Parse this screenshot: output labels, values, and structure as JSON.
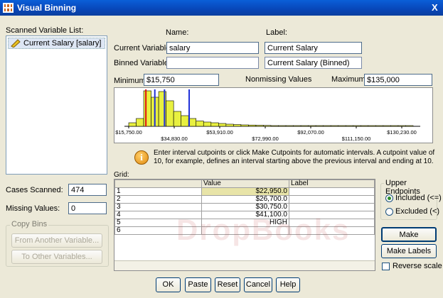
{
  "window": {
    "title": "Visual Binning",
    "close_glyph": "X"
  },
  "scanned": {
    "label": "Scanned Variable List:",
    "items": [
      "Current Salary [salary]"
    ]
  },
  "headers": {
    "name": "Name:",
    "label": "Label:"
  },
  "current_variable": {
    "label": "Current Variable:",
    "name": "salary",
    "var_label": "Current Salary"
  },
  "binned_variable": {
    "label": "Binned Variable:",
    "name": "",
    "var_label": "Current Salary (Binned)"
  },
  "stats": {
    "minimum_label": "Minimum:",
    "minimum": "$15,750",
    "nonmissing_label": "Nonmissing Values",
    "maximum_label": "Maximum:",
    "maximum": "$135,000"
  },
  "histogram": {
    "bars": [
      0.1,
      0.22,
      1.0,
      0.82,
      0.98,
      0.72,
      0.42,
      0.3,
      0.22,
      0.15,
      0.12,
      0.1,
      0.08,
      0.06,
      0.05,
      0.04,
      0.035,
      0.03,
      0.025,
      0.02,
      0.02,
      0.015,
      0.015,
      0.01,
      0.01,
      0.01,
      0.01,
      0.008,
      0.008,
      0.005,
      0.005,
      0.004,
      0.004,
      0.003,
      0.003,
      0.002,
      0.002,
      0.002
    ],
    "xmin": 15750,
    "xmax": 135000,
    "cutpoints": [
      22950,
      26700,
      30750,
      41100
    ],
    "highlight_cutpoint": 22950,
    "tick_labels_top": [
      "$15,750.00",
      "$53,910.00",
      "$92,070.00",
      "$130,230.00"
    ],
    "tick_labels_bottom": [
      "$34,830.00",
      "$72,990.00",
      "$111,150.00"
    ],
    "bar_color": "#e8f040",
    "cut_color": "#1f2fd8",
    "highlight_color": "#e01010"
  },
  "info": {
    "text": "Enter interval cutpoints or click Make Cutpoints for automatic intervals. A cutpoint value of 10, for example, defines an interval starting above the previous interval and ending at 10."
  },
  "grid": {
    "label": "Grid:",
    "columns": [
      "",
      "Value",
      "Label"
    ],
    "rows": [
      {
        "n": "1",
        "value": "$22,950.0",
        "label": ""
      },
      {
        "n": "2",
        "value": "$26,700.0",
        "label": ""
      },
      {
        "n": "3",
        "value": "$30,750.0",
        "label": ""
      },
      {
        "n": "4",
        "value": "$41,100.0",
        "label": ""
      },
      {
        "n": "5",
        "value": "HIGH",
        "label": ""
      },
      {
        "n": "6",
        "value": "",
        "label": ""
      }
    ]
  },
  "cases": {
    "scanned_label": "Cases Scanned:",
    "scanned": "474",
    "missing_label": "Missing Values:",
    "missing": "0"
  },
  "copy_bins": {
    "label": "Copy Bins",
    "from": "From Another Variable...",
    "to": "To Other Variables..."
  },
  "upper_endpoints": {
    "label": "Upper Endpoints",
    "included": "Included (<=)",
    "excluded": "Excluded (<)"
  },
  "actions": {
    "make_cutpoints": "Make Cutpoints...",
    "make_labels": "Make Labels",
    "reverse": "Reverse scale"
  },
  "footer": {
    "ok": "OK",
    "paste": "Paste",
    "reset": "Reset",
    "cancel": "Cancel",
    "help": "Help"
  },
  "watermark": "DropBooks"
}
